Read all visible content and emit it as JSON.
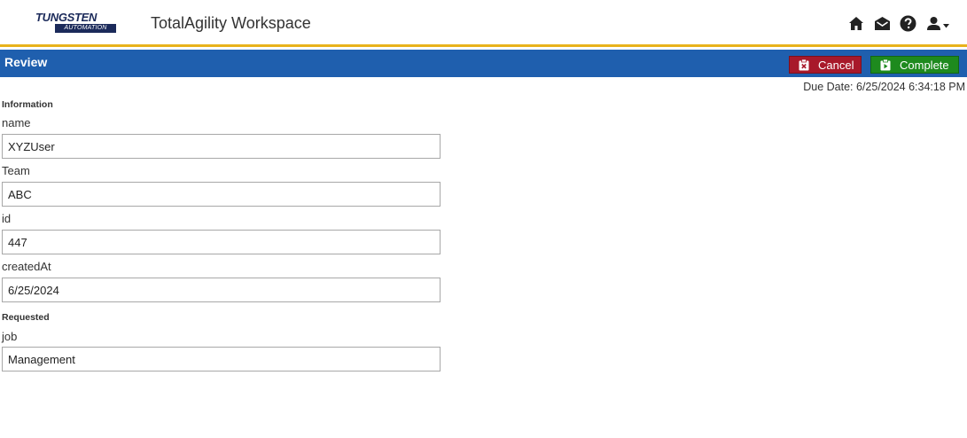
{
  "app": {
    "logo_top": "TUNGSTEN",
    "logo_bottom": "AUTOMATION",
    "title": "TotalAgility Workspace",
    "icons": [
      "home-icon",
      "inbox-icon",
      "help-icon",
      "user-icon",
      "caret-down-icon"
    ]
  },
  "header": {
    "title": "Review",
    "cancel_label": "Cancel",
    "complete_label": "Complete"
  },
  "due_date": "Due Date: 6/25/2024 6:34:18 PM",
  "form": {
    "section_information": "Information",
    "name_label": "name",
    "name_value": "XYZUser",
    "team_label": "Team",
    "team_value": "ABC",
    "id_label": "id",
    "id_value": "447",
    "createdAt_label": "createdAt",
    "createdAt_value": "6/25/2024",
    "section_requested": "Requested",
    "job_label": "job",
    "job_value": "Management"
  },
  "colors": {
    "header_bar": "#1f5fae",
    "accent_line": "#e8b21b",
    "cancel": "#a8192a",
    "complete": "#1e8a1e"
  }
}
